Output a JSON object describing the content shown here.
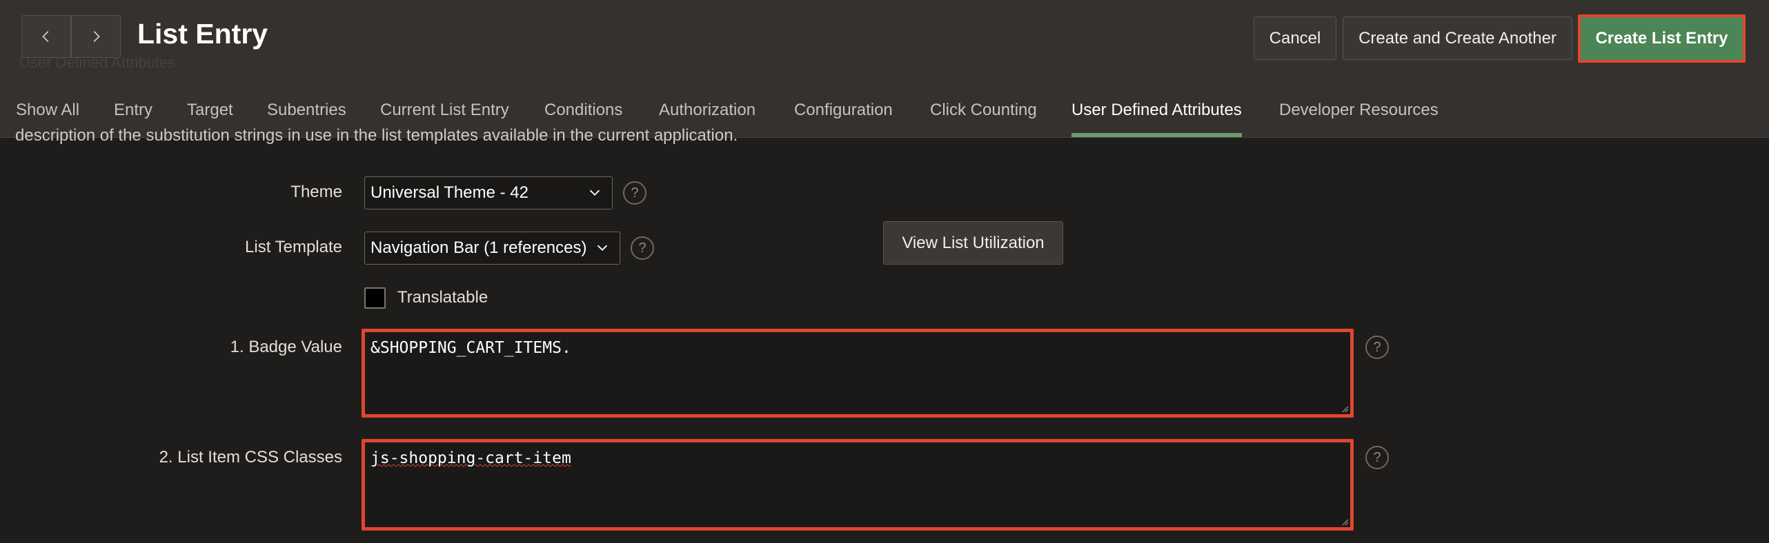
{
  "header": {
    "title": "List Entry",
    "back_icon": "chevron-left-icon",
    "forward_icon": "chevron-right-icon",
    "buttons": {
      "cancel": "Cancel",
      "create_another": "Create and Create Another",
      "create": "Create List Entry"
    },
    "faint_subtitle": "User Defined Attributes"
  },
  "tabs": [
    {
      "label": "Show All"
    },
    {
      "label": "Entry"
    },
    {
      "label": "Target"
    },
    {
      "label": "Subentries"
    },
    {
      "label": "Current List Entry"
    },
    {
      "label": "Conditions"
    },
    {
      "label": "Authorization"
    },
    {
      "label": "Configuration"
    },
    {
      "label": "Click Counting"
    },
    {
      "label": "User Defined Attributes",
      "active": true
    },
    {
      "label": "Developer Resources"
    }
  ],
  "description_tail": "description of the substitution strings in use in the list templates available in the current application.",
  "form": {
    "theme": {
      "label": "Theme",
      "value": "Universal Theme - 42"
    },
    "list_template": {
      "label": "List Template",
      "value": "Navigation Bar (1 references)"
    },
    "view_utilization": "View List Utilization",
    "translatable": {
      "label": "Translatable",
      "checked": false
    },
    "badge_value": {
      "label": "1. Badge Value",
      "value": "&SHOPPING_CART_ITEMS."
    },
    "css_classes": {
      "label": "2. List Item CSS Classes",
      "value": "js-shopping-cart-item"
    },
    "help_glyph": "?"
  },
  "colors": {
    "accent_green": "#4c8556",
    "highlight_red": "#e0462f",
    "tab_underline": "#6a9a70"
  }
}
